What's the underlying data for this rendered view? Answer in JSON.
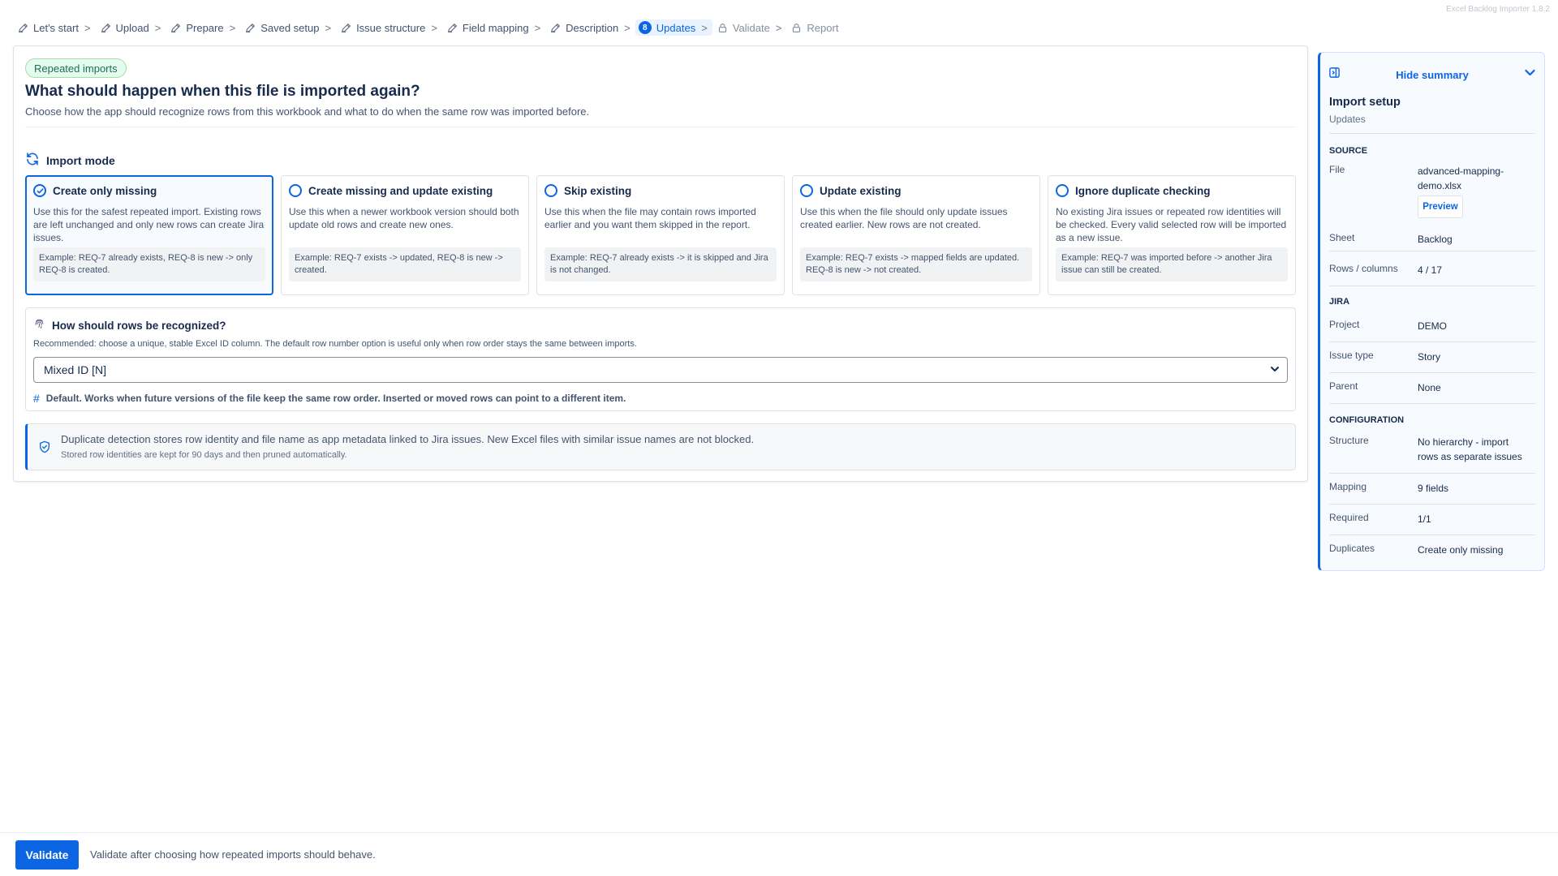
{
  "app": {
    "version": "Excel Backlog Importer 1.8.2"
  },
  "colors": {
    "accent": "#0c66e4",
    "success_bg": "#e3fcef",
    "success_fg": "#216e4e"
  },
  "breadcrumb": [
    {
      "label": "Let's start",
      "state": "done",
      "icon": "pencil-icon"
    },
    {
      "label": "Upload",
      "state": "done",
      "icon": "pencil-icon"
    },
    {
      "label": "Prepare",
      "state": "done",
      "icon": "pencil-icon"
    },
    {
      "label": "Saved setup",
      "state": "done",
      "icon": "pencil-icon"
    },
    {
      "label": "Issue structure",
      "state": "done",
      "icon": "pencil-icon"
    },
    {
      "label": "Field mapping",
      "state": "done",
      "icon": "pencil-icon"
    },
    {
      "label": "Description",
      "state": "done",
      "icon": "pencil-icon"
    },
    {
      "label": "Updates",
      "state": "active",
      "number": "8"
    },
    {
      "label": "Validate",
      "state": "locked",
      "icon": "lock-icon"
    },
    {
      "label": "Report",
      "state": "locked",
      "icon": "lock-icon"
    }
  ],
  "breadcrumb_separator": ">",
  "main": {
    "pill": "Repeated imports",
    "title": "What should happen when this file is imported again?",
    "description": "Choose how the app should recognize rows from this workbook and what to do when the same row was imported before.",
    "import_mode_heading": "Import mode",
    "modes": [
      {
        "title": "Create only missing",
        "selected": true,
        "description": "Use this for the safest repeated import. Existing rows are left unchanged and only new rows can create Jira issues.",
        "example": "Example: REQ-7 already exists, REQ-8 is new -> only REQ-8 is created."
      },
      {
        "title": "Create missing and update existing",
        "selected": false,
        "description": "Use this when a newer workbook version should both update old rows and create new ones.",
        "example": "Example: REQ-7 exists -> updated, REQ-8 is new -> created."
      },
      {
        "title": "Skip existing",
        "selected": false,
        "description": "Use this when the file may contain rows imported earlier and you want them skipped in the report.",
        "example": "Example: REQ-7 already exists -> it is skipped and Jira is not changed."
      },
      {
        "title": "Update existing",
        "selected": false,
        "description": "Use this when the file should only update issues created earlier. New rows are not created.",
        "example": "Example: REQ-7 exists -> mapped fields are updated. REQ-8 is new -> not created."
      },
      {
        "title": "Ignore duplicate checking",
        "selected": false,
        "description": "No existing Jira issues or repeated row identities will be checked. Every valid selected row will be imported as a new issue.",
        "example": "Example: REQ-7 was imported before -> another Jira issue can still be created."
      }
    ],
    "recognition": {
      "heading": "How should rows be recognized?",
      "hint": "Recommended: choose a unique, stable Excel ID column. The default row number option is useful only when row order stays the same between imports.",
      "selected_value": "Mixed ID [N]",
      "note_symbol": "#",
      "note": "Default. Works when future versions of the file keep the same row order. Inserted or moved rows can point to a different item."
    },
    "info": {
      "text": "Duplicate detection stores row identity and file name as app metadata linked to Jira issues. New Excel files with similar issue names are not blocked.",
      "subtext": "Stored row identities are kept for 90 days and then pruned automatically."
    }
  },
  "summary": {
    "hide_label": "Hide summary",
    "title": "Import setup",
    "subtitle": "Updates",
    "source_heading": "SOURCE",
    "file_label": "File",
    "file_value": "advanced-mapping-demo.xlsx",
    "preview_label": "Preview",
    "sheet_label": "Sheet",
    "sheet_value": "Backlog",
    "rows_label": "Rows / columns",
    "rows_value": "4 / 17",
    "jira_heading": "JIRA",
    "project_label": "Project",
    "project_value": "DEMO",
    "issue_type_label": "Issue type",
    "issue_type_value": "Story",
    "parent_label": "Parent",
    "parent_value": "None",
    "config_heading": "CONFIGURATION",
    "structure_label": "Structure",
    "structure_value": "No hierarchy - import rows as separate issues",
    "mapping_label": "Mapping",
    "mapping_value": "9 fields",
    "required_label": "Required",
    "required_value": "1/1",
    "duplicates_label": "Duplicates",
    "duplicates_value": "Create only missing"
  },
  "footer": {
    "validate_label": "Validate",
    "note": "Validate after choosing how repeated imports should behave."
  }
}
